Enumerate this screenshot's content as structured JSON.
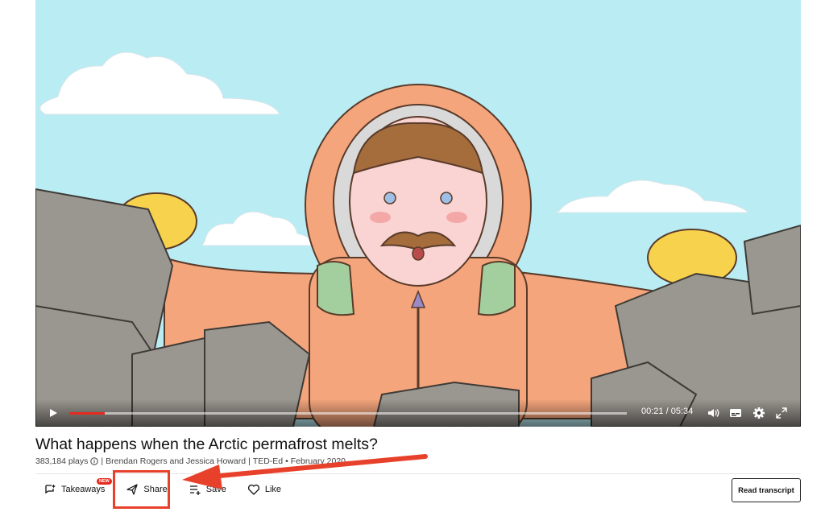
{
  "video": {
    "current_time": "00:21",
    "duration": "05:34",
    "time_display": "00:21 / 05:34",
    "progress_fraction": 0.063
  },
  "title": "What happens when the Arctic permafrost melts?",
  "meta": {
    "plays": "383,184 plays",
    "authors": "Brendan Rogers and Jessica Howard",
    "separator": "|",
    "channel": "TED-Ed",
    "date": "• February 2020"
  },
  "actions": {
    "takeaways": "Takeaways",
    "new_badge": "NEW",
    "share": "Share",
    "save": "Save",
    "like": "Like",
    "read_transcript": "Read transcript"
  },
  "colors": {
    "accent": "#e62b1e",
    "annotation": "#e8412b",
    "sky": "#b9ecf3"
  }
}
